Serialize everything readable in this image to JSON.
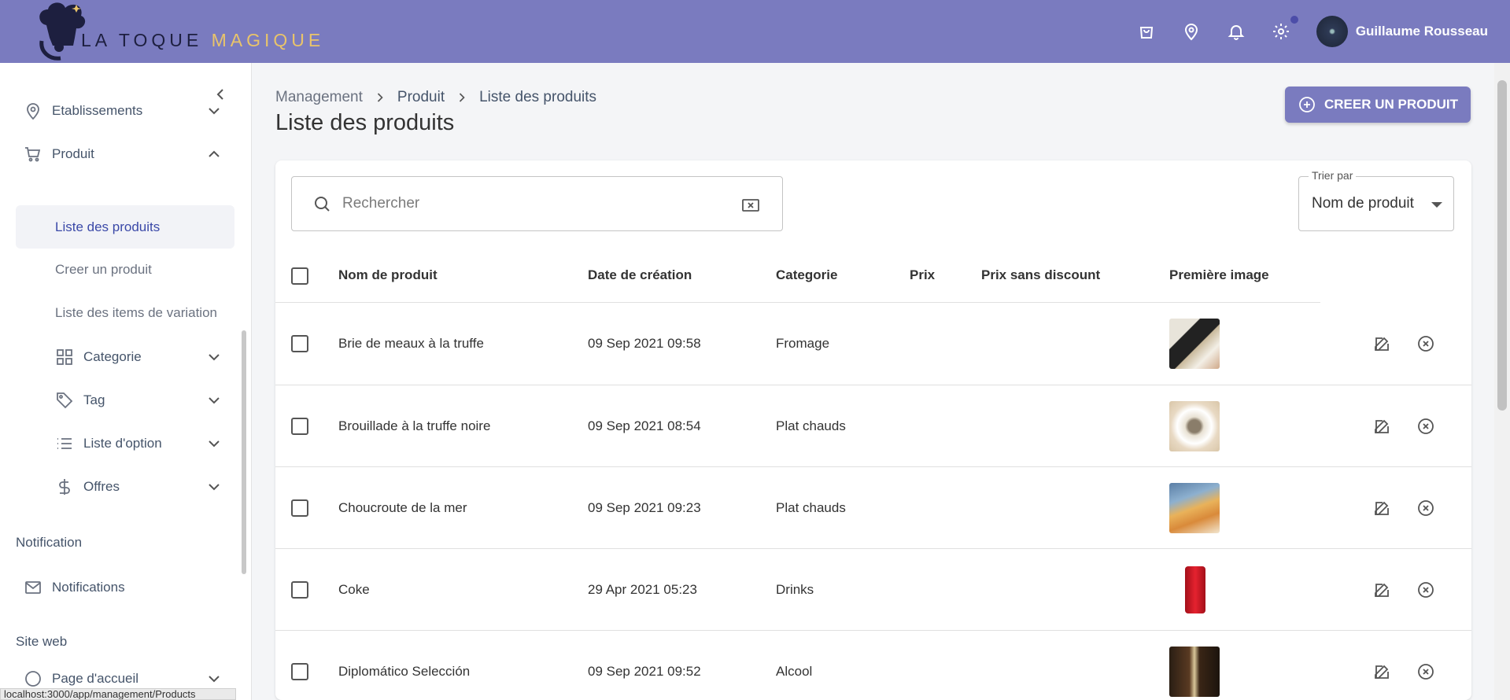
{
  "brand": {
    "name_part1": "LA TOQUE ",
    "name_part2": "MAGIQUE",
    "color": "#7a7bbf"
  },
  "topbar": {
    "icons": [
      "shopping-bag-icon",
      "location-pin-icon",
      "bell-icon",
      "settings-icon"
    ],
    "user_name": "Guillaume Rousseau"
  },
  "sidebar": {
    "items": [
      {
        "label": "Etablissements",
        "icon": "location-pin-icon"
      },
      {
        "label": "Produit",
        "icon": "cart-icon"
      }
    ],
    "produit_sub": [
      {
        "label": "Liste des produits"
      },
      {
        "label": "Creer un produit"
      },
      {
        "label": "Liste des items de variation"
      }
    ],
    "groups": [
      {
        "label": "Categorie",
        "icon": "grid-icon"
      },
      {
        "label": "Tag",
        "icon": "tag-icon"
      },
      {
        "label": "Liste d'option",
        "icon": "list-icon"
      },
      {
        "label": "Offres",
        "icon": "dollar-icon"
      }
    ],
    "section_notification": "Notification",
    "notifications_label": "Notifications",
    "section_site_web": "Site web",
    "page_accueil": "Page d'accueil"
  },
  "status_url": "localhost:3000/app/management/Products",
  "breadcrumb": [
    "Management",
    "Produit",
    "Liste des produits"
  ],
  "page_title": "Liste des produits",
  "create_button": "CREER UN PRODUIT",
  "search": {
    "placeholder": "Rechercher"
  },
  "sort": {
    "label": "Trier par",
    "value": "Nom de produit"
  },
  "table": {
    "columns": [
      "Nom de produit",
      "Date de création",
      "Categorie",
      "Prix",
      "Prix sans discount",
      "Première image"
    ],
    "rows": [
      {
        "name": "Brie de meaux à la truffe",
        "date": "09 Sep 2021 09:58",
        "category": "Fromage",
        "price": "",
        "price_no_discount": ""
      },
      {
        "name": "Brouillade à la truffe noire",
        "date": "09 Sep 2021 08:54",
        "category": "Plat chauds",
        "price": "",
        "price_no_discount": ""
      },
      {
        "name": "Choucroute de la mer",
        "date": "09 Sep 2021 09:23",
        "category": "Plat chauds",
        "price": "",
        "price_no_discount": ""
      },
      {
        "name": "Coke",
        "date": "29 Apr 2021 05:23",
        "category": "Drinks",
        "price": "",
        "price_no_discount": ""
      },
      {
        "name": "Diplomático Selección",
        "date": "09 Sep 2021 09:52",
        "category": "Alcool",
        "price": "",
        "price_no_discount": ""
      }
    ]
  }
}
